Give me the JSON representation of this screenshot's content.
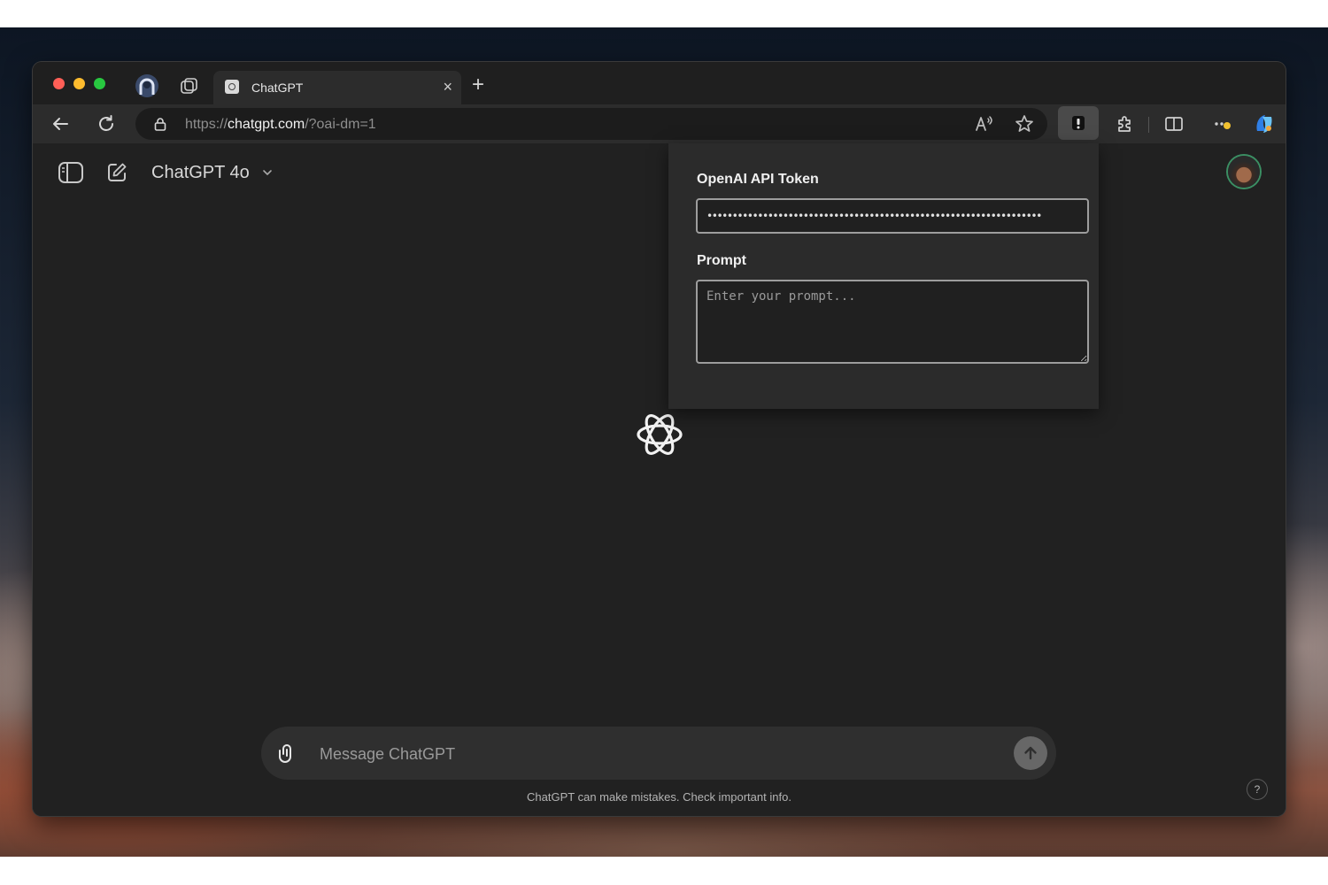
{
  "browser": {
    "tab": {
      "title": "ChatGPT",
      "close": "×"
    },
    "new_tab": "+",
    "address": {
      "scheme": "https://",
      "domain": "chatgpt.com",
      "path": "/?oai-dm=1"
    }
  },
  "header": {
    "model_title": "ChatGPT 4o"
  },
  "extension_popup": {
    "token_label": "OpenAI API Token",
    "token_value": "••••••••••••••••••••••••••••••••••••••••••••••••••••••••••••••••••",
    "prompt_label": "Prompt",
    "prompt_placeholder": "Enter your prompt..."
  },
  "composer": {
    "placeholder": "Message ChatGPT"
  },
  "footer": {
    "disclaimer": "ChatGPT can make mistakes. Check important info.",
    "help": "?"
  },
  "colors": {
    "traffic_red": "#ff5f57",
    "traffic_yellow": "#febc2e",
    "traffic_green": "#28c840",
    "page_background": "#212121",
    "composer_background": "#2f2f2f"
  }
}
